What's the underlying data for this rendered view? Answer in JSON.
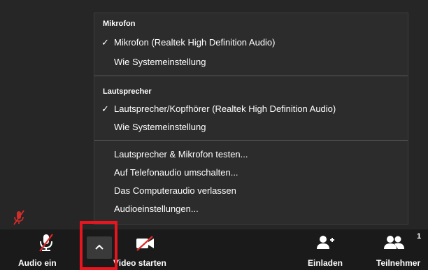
{
  "menu": {
    "section_microphone": "Mikrofon",
    "mic_items": [
      {
        "label": "Mikrofon (Realtek High Definition Audio)",
        "checked": true
      },
      {
        "label": "Wie Systemeinstellung",
        "checked": false
      }
    ],
    "section_speaker": "Lautsprecher",
    "speaker_items": [
      {
        "label": "Lautsprecher/Kopfhörer (Realtek High Definition Audio)",
        "checked": true
      },
      {
        "label": "Wie Systemeinstellung",
        "checked": false
      }
    ],
    "actions": [
      "Lautsprecher & Mikrofon testen...",
      "Auf Telefonaudio umschalten...",
      "Das Computeraudio verlassen",
      "Audioeinstellungen..."
    ],
    "check_glyph": "✓"
  },
  "toolbar": {
    "audio_label": "Audio ein",
    "video_label": "Video starten",
    "invite_label": "Einladen",
    "participants_label": "Teilnehmer",
    "participants_count": "1"
  },
  "colors": {
    "highlight_border": "#e8141e",
    "mute_slash": "#e02828",
    "menu_bg": "#2c2c2c",
    "toolbar_bg": "#1a1a1a"
  }
}
